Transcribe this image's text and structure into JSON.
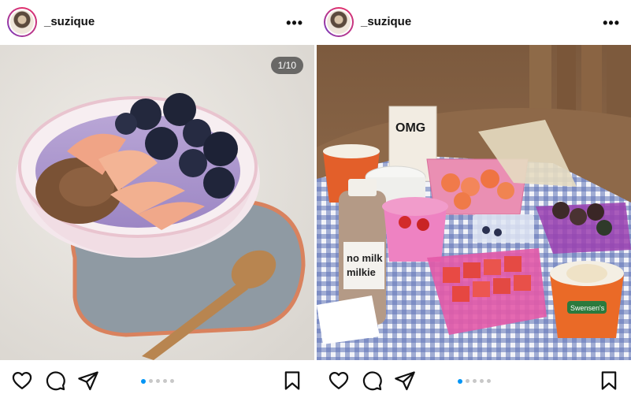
{
  "posts": [
    {
      "username": "_suzique",
      "more_label": "•••",
      "counter": "1/10",
      "carousel": {
        "total_dots": 5,
        "active_index": 0
      },
      "icons": {
        "like": "heart-icon",
        "comment": "comment-bubble-icon",
        "share": "paper-plane-icon",
        "save": "bookmark-icon"
      }
    },
    {
      "username": "_suzique",
      "more_label": "•••",
      "counter": "",
      "carousel": {
        "total_dots": 5,
        "active_index": 0
      },
      "labels": {
        "carton": "OMG",
        "bottle_line1": "no milk",
        "bottle_line2": "milkie",
        "cup_brand": "Swensen's"
      },
      "icons": {
        "like": "heart-icon",
        "comment": "comment-bubble-icon",
        "share": "paper-plane-icon",
        "save": "bookmark-icon"
      }
    }
  ],
  "colors": {
    "accent_dot": "#0095f6",
    "inactive_dot": "#c8c8c8",
    "text": "#111111"
  }
}
